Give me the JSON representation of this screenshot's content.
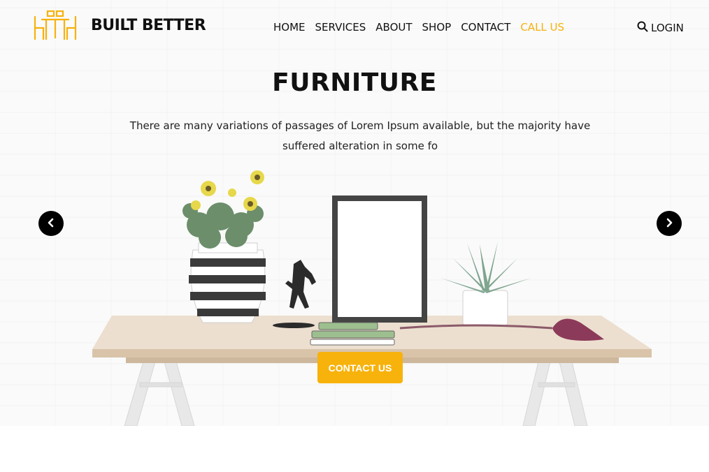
{
  "brand": {
    "name": "BUILT BETTER",
    "logo_icon": "furniture-table-chairs-icon",
    "accent_color": "#f7b20c"
  },
  "nav": {
    "items": [
      {
        "label": "HOME"
      },
      {
        "label": "SERVICES"
      },
      {
        "label": "ABOUT"
      },
      {
        "label": "SHOP"
      },
      {
        "label": "CONTACT"
      },
      {
        "label": "CALL US",
        "accent": true
      }
    ],
    "login_label": "LOGIN",
    "login_icon": "search-icon"
  },
  "hero": {
    "title": "FURNITURE",
    "subtitle": "There are many variations of passages of Lorem Ipsum available, but the majority have suffered alteration in some fo",
    "cta_label": "CONTACT US",
    "prev_icon": "chevron-left-icon",
    "next_icon": "chevron-right-icon"
  }
}
